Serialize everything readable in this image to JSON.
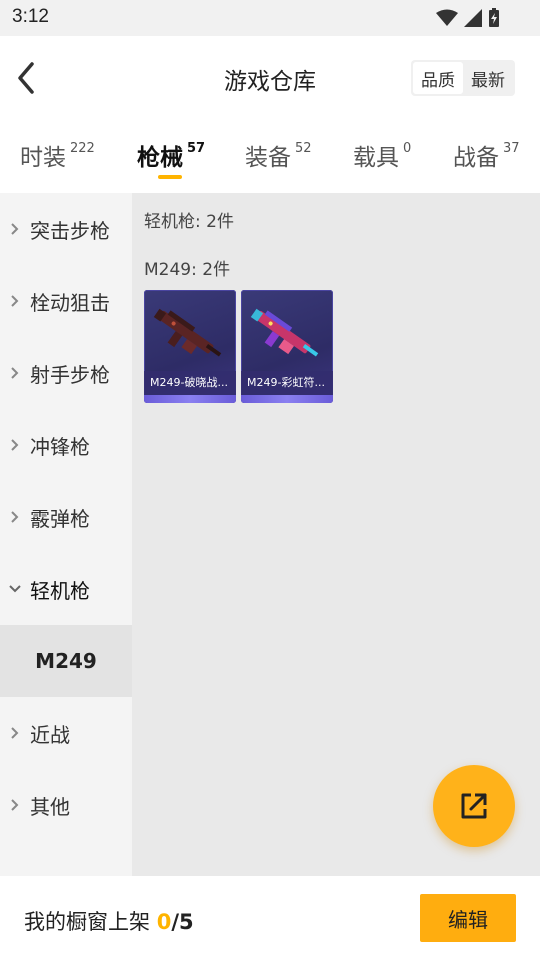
{
  "status_bar": {
    "time": "3:12"
  },
  "header": {
    "title": "游戏仓库"
  },
  "sort": {
    "options": [
      "品质",
      "最新"
    ],
    "selected": "品质"
  },
  "tabs": [
    {
      "label": "时装",
      "count": "222"
    },
    {
      "label": "枪械",
      "count": "57"
    },
    {
      "label": "装备",
      "count": "52"
    },
    {
      "label": "载具",
      "count": "0"
    },
    {
      "label": "战备",
      "count": "37"
    }
  ],
  "active_tab": "枪械",
  "sidebar": {
    "items": [
      {
        "label": "突击步枪"
      },
      {
        "label": "栓动狙击"
      },
      {
        "label": "射手步枪"
      },
      {
        "label": "冲锋枪"
      },
      {
        "label": "霰弹枪"
      },
      {
        "label": "轻机枪"
      },
      {
        "label": "近战"
      },
      {
        "label": "其他"
      }
    ],
    "expanded": "轻机枪",
    "sub_item": "M249"
  },
  "content": {
    "group_title": "轻机枪: 2件",
    "sub_title": "M249: 2件",
    "cards": [
      {
        "label": "M249-破晓战...",
        "gun_color": "#6b2a2a"
      },
      {
        "label": "M249-彩虹符...",
        "gun_color": "#d23a6a"
      }
    ]
  },
  "bottom": {
    "shelf_label": "我的橱窗上架",
    "shelf_count": "0",
    "shelf_total": "/5",
    "edit_label": "编辑"
  },
  "colors": {
    "accent": "#ffb400",
    "card_bg": "#2e2c66"
  }
}
